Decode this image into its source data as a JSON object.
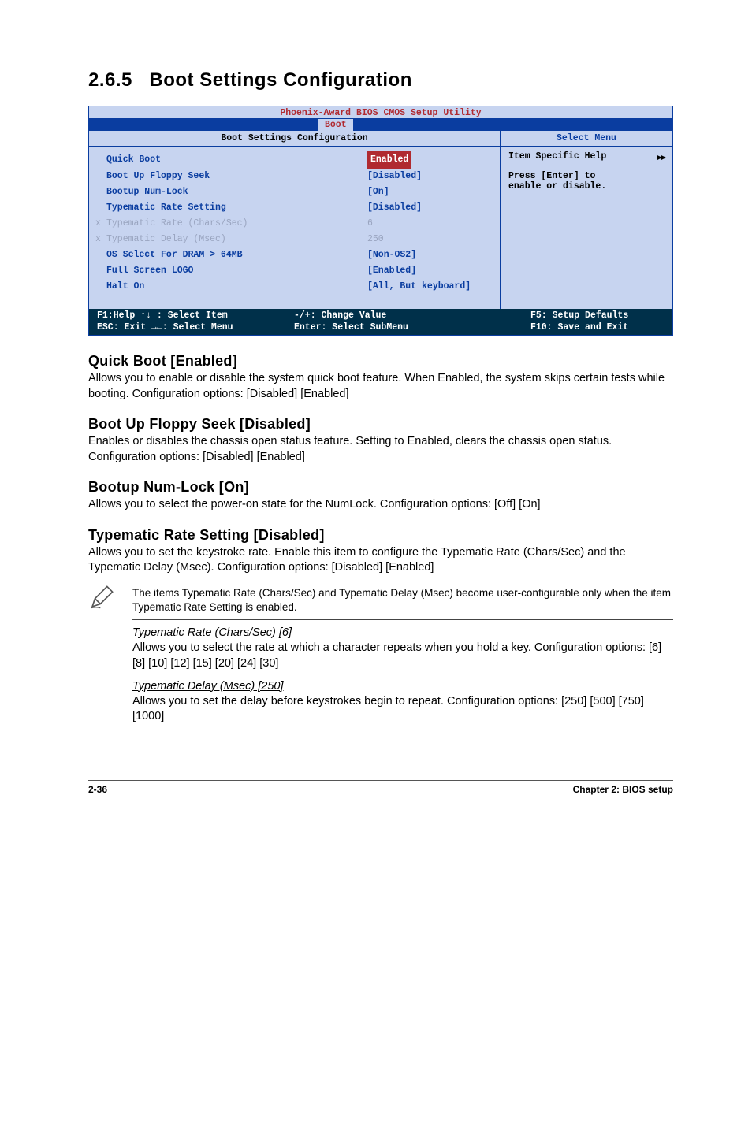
{
  "section_number": "2.6.5",
  "section_title": "Boot Settings Configuration",
  "bios": {
    "titlebar": "Phoenix-Award BIOS CMOS Setup Utility",
    "tab": "Boot",
    "left_title": "Boot Settings Configuration",
    "right_title": "Select Menu",
    "rows": [
      {
        "marker": "",
        "label": "Quick Boot",
        "value": "Enabled",
        "highlight": true,
        "disabled": false
      },
      {
        "marker": "",
        "label": "Boot Up Floppy Seek",
        "value": "[Disabled]",
        "highlight": false,
        "disabled": false
      },
      {
        "marker": "",
        "label": "Bootup Num-Lock",
        "value": "[On]",
        "highlight": false,
        "disabled": false
      },
      {
        "marker": "",
        "label": "Typematic Rate Setting",
        "value": "[Disabled]",
        "highlight": false,
        "disabled": false
      },
      {
        "marker": "x",
        "label": "Typematic Rate (Chars/Sec)",
        "value": " 6",
        "highlight": false,
        "disabled": true
      },
      {
        "marker": "x",
        "label": "Typematic Delay (Msec)",
        "value": " 250",
        "highlight": false,
        "disabled": true
      },
      {
        "marker": "",
        "label": "OS Select For DRAM > 64MB",
        "value": "[Non-OS2]",
        "highlight": false,
        "disabled": false
      },
      {
        "marker": "",
        "label": "Full Screen LOGO",
        "value": "[Enabled]",
        "highlight": false,
        "disabled": false
      },
      {
        "marker": "",
        "label": "Halt On",
        "value": "[All, But keyboard]",
        "highlight": false,
        "disabled": false
      }
    ],
    "help": {
      "title": "Item Specific Help",
      "lines": [
        "Press [Enter] to",
        "enable or disable."
      ]
    },
    "footer": {
      "col1a": "F1:Help    ↑↓ : Select Item",
      "col1b": "ESC: Exit  →←: Select Menu",
      "col2a": "-/+: Change Value",
      "col2b": "Enter: Select SubMenu",
      "col3a": "F5: Setup Defaults",
      "col3b": "F10: Save and Exit"
    }
  },
  "sub1": {
    "heading": "Quick Boot [Enabled]",
    "body": "Allows you to enable or disable the system quick boot feature. When Enabled, the system skips certain tests while booting. Configuration options: [Disabled] [Enabled]"
  },
  "sub2": {
    "heading": "Boot Up Floppy Seek [Disabled]",
    "body": "Enables or disables the chassis open status feature. Setting to Enabled, clears the chassis open status. Configuration options: [Disabled] [Enabled]"
  },
  "sub3": {
    "heading": "Bootup Num-Lock [On]",
    "body": "Allows you to select the power-on state for the NumLock. Configuration options: [Off] [On]"
  },
  "sub4": {
    "heading": "Typematic Rate Setting [Disabled]",
    "body": "Allows you to set the keystroke rate. Enable this item to configure the Typematic Rate (Chars/Sec) and the Typematic Delay (Msec). Configuration options: [Disabled] [Enabled]"
  },
  "note": "The items Typematic Rate (Chars/Sec) and Typematic Delay (Msec) become user-configurable only when the item Typematic Rate Setting is enabled.",
  "indent1": {
    "title": "Typematic Rate (Chars/Sec) [6]",
    "body": "Allows you to select the rate at which a character repeats when you hold a key. Configuration options: [6] [8] [10] [12] [15] [20] [24] [30]"
  },
  "indent2": {
    "title": "Typematic Delay (Msec) [250]",
    "body": "Allows you to set the delay before keystrokes begin to repeat. Configuration options: [250] [500] [750] [1000]"
  },
  "footer": {
    "left": "2-36",
    "right": "Chapter 2: BIOS setup"
  }
}
